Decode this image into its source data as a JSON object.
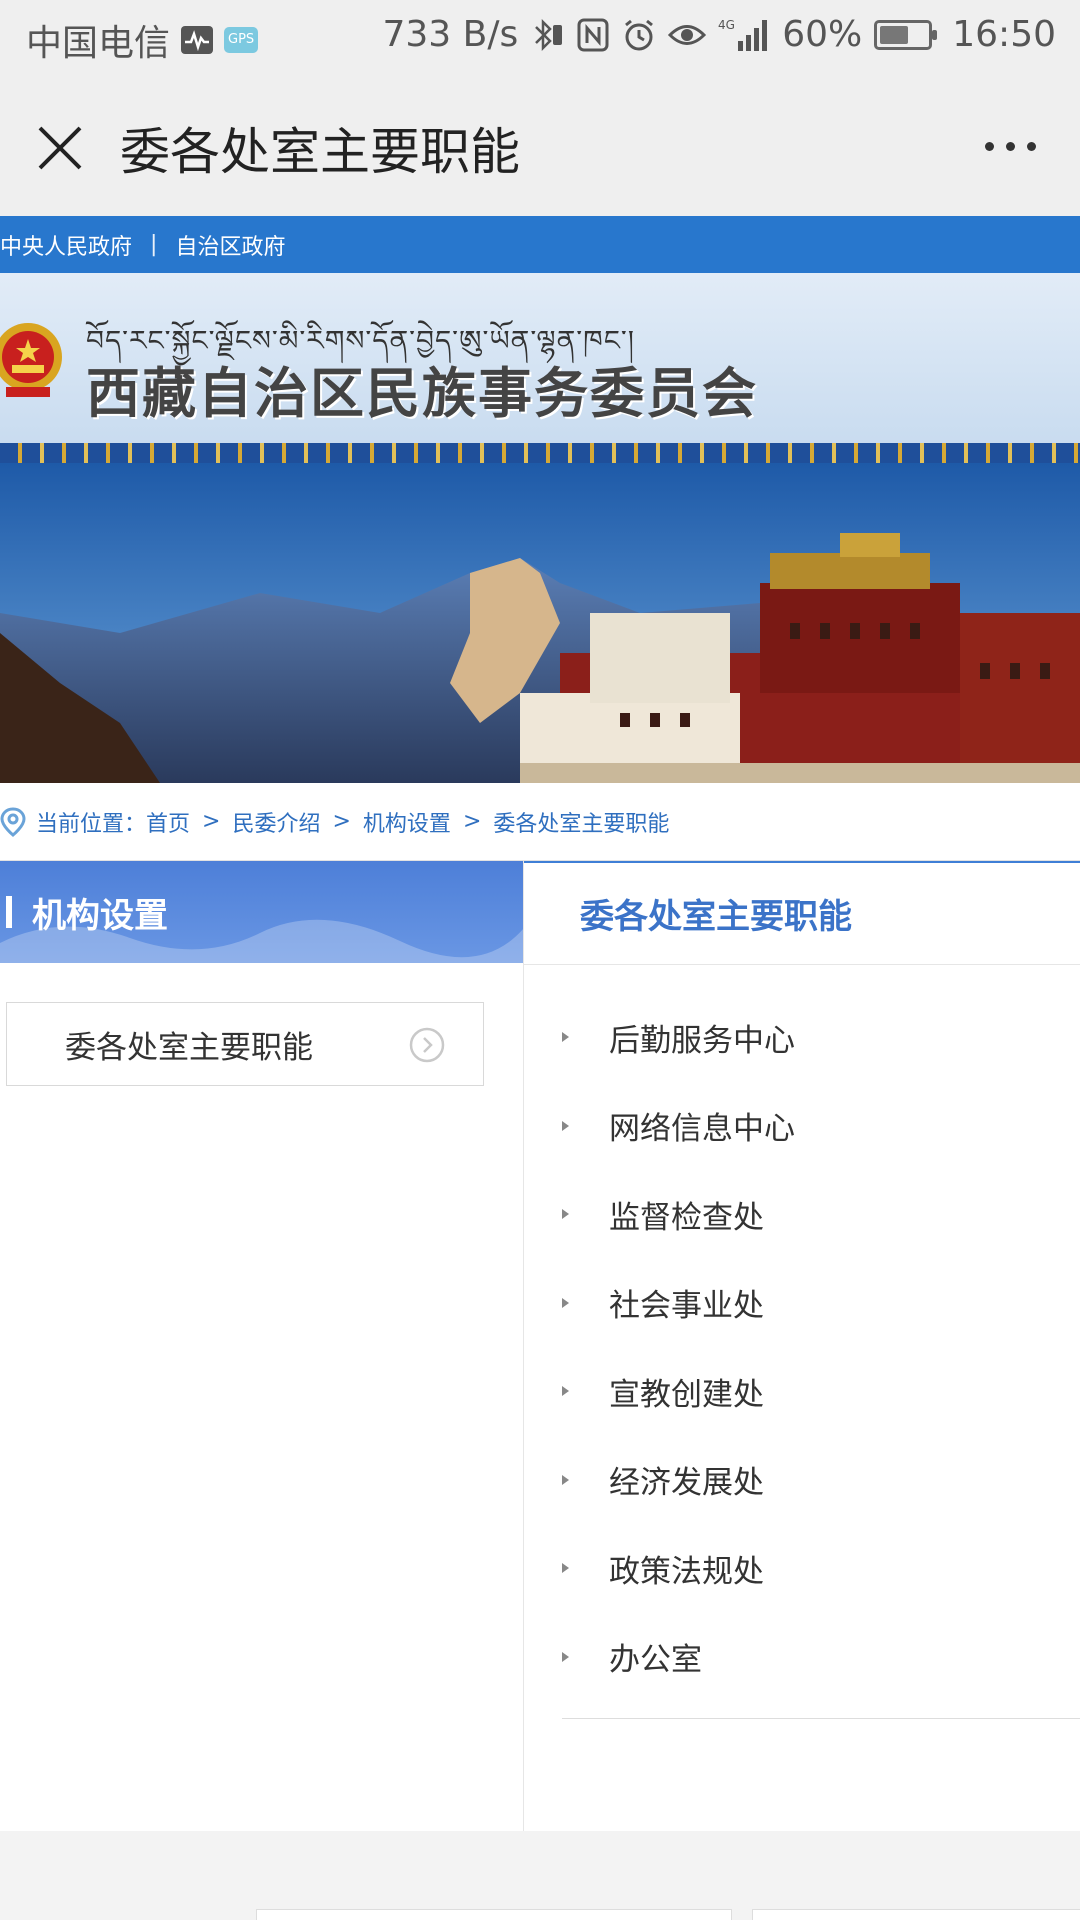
{
  "status_bar": {
    "carrier": "中国电信",
    "gps_badge": "GPS",
    "net_speed": "733 B/s",
    "network_label": "4G",
    "battery_text": "60%",
    "battery_level": 0.6,
    "time": "16:50"
  },
  "navbar": {
    "title": "委各处室主要职能"
  },
  "top_links": {
    "link1": "中央人民政府",
    "separator": "|",
    "link2": "自治区政府"
  },
  "header": {
    "tibetan_title": "བོད་རང་སྐྱོང་ལྗོངས་མི་རིགས་དོན་བྱེད་ཨུ་ཡོན་ལྷན་ཁང་།",
    "site_title": "西藏自治区民族事务委员会"
  },
  "breadcrumb": {
    "label": "当前位置：",
    "items": [
      "首页",
      "民委介绍",
      "机构设置",
      "委各处室主要职能"
    ],
    "separator": ">"
  },
  "sidebar": {
    "title": "机构设置",
    "items": [
      {
        "label": "委各处室主要职能"
      }
    ]
  },
  "content": {
    "title": "委各处室主要职能",
    "items": [
      {
        "label": "后勤服务中心"
      },
      {
        "label": "网络信息中心"
      },
      {
        "label": "监督检查处"
      },
      {
        "label": "社会事业处"
      },
      {
        "label": "宣教创建处"
      },
      {
        "label": "经济发展处"
      },
      {
        "label": "政策法规处"
      },
      {
        "label": "办公室"
      }
    ]
  },
  "colors": {
    "accent_blue": "#2877cd",
    "sidebar_head": "#4d7fd8",
    "content_title": "#3b73c8"
  },
  "icons": [
    "activity-icon",
    "bluetooth-icon",
    "nfc-icon",
    "alarm-icon",
    "eye-icon",
    "signal-icon",
    "battery-icon",
    "close-icon",
    "more-icon",
    "location-pin-icon",
    "chevron-circle-right-icon",
    "emblem-icon"
  ]
}
